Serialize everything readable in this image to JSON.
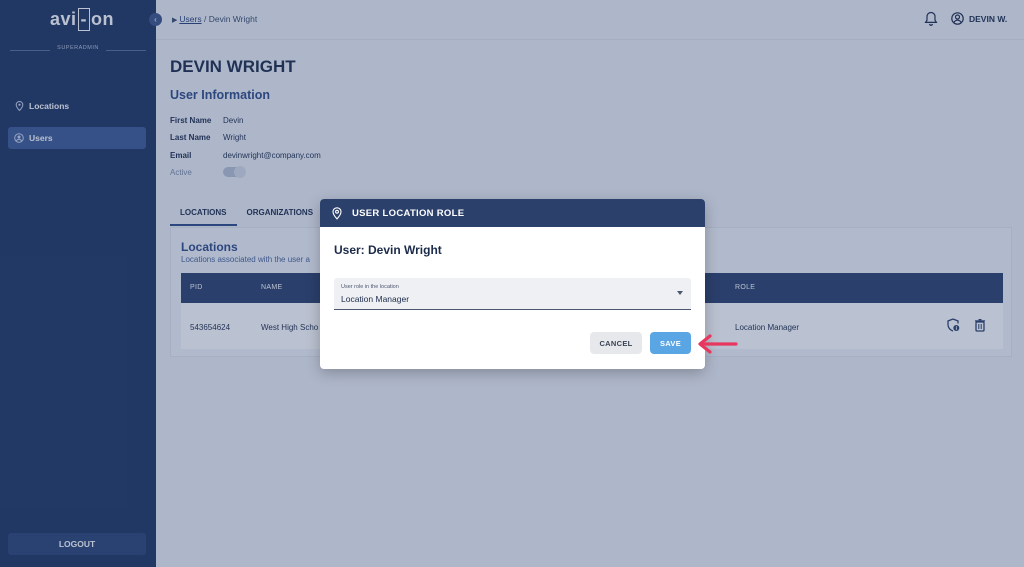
{
  "sidebar": {
    "logo_parts": [
      "avi",
      "-",
      "on"
    ],
    "role_label": "SUPERADMIN",
    "items": [
      {
        "label": "Locations",
        "icon": "location-pin-icon"
      },
      {
        "label": "Users",
        "icon": "user-circle-icon"
      }
    ],
    "logout_label": "LOGOUT",
    "colors": {
      "bg": "#1f3560",
      "active": "#3d5a94"
    }
  },
  "header": {
    "breadcrumb": {
      "link": "Users",
      "separator": "/",
      "current": "Devin Wright"
    },
    "user_name": "DEVIN W."
  },
  "main": {
    "title": "DEVIN WRIGHT",
    "section_title": "User Information",
    "fields": [
      {
        "label": "First Name",
        "value": "Devin"
      },
      {
        "label": "Last Name",
        "value": "Wright"
      },
      {
        "label": "Email",
        "value": "devinwright@company.com"
      }
    ],
    "active_label": "Active",
    "active_on": true,
    "tabs": [
      {
        "label": "LOCATIONS",
        "active": true
      },
      {
        "label": "ORGANIZATIONS",
        "active": false
      }
    ],
    "card": {
      "title": "Locations",
      "subtitle": "Locations associated with the user a",
      "columns": {
        "pid": "PID",
        "name": "NAME",
        "role": "ROLE"
      },
      "rows": [
        {
          "pid": "543654624",
          "name": "West High Scho",
          "role": "Location Manager"
        }
      ]
    }
  },
  "modal": {
    "title": "USER LOCATION ROLE",
    "user_line": "User: Devin Wright",
    "select_label": "User role in the location",
    "select_value": "Location Manager",
    "cancel_label": "CANCEL",
    "save_label": "SAVE",
    "colors": {
      "header": "#2b406b",
      "save": "#5aa5e3",
      "arrow": "#e8375f"
    }
  }
}
